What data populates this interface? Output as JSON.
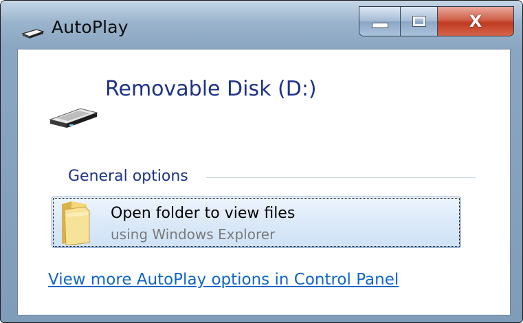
{
  "window": {
    "title": "AutoPlay",
    "title_icon": "autoplay-drive-icon",
    "controls": {
      "minimize_icon": "minimize-icon",
      "maximize_icon": "maximize-icon",
      "close_icon": "close-icon",
      "close_glyph": "X"
    }
  },
  "device": {
    "name": "Removable Disk (D:)",
    "icon": "removable-disk-icon"
  },
  "sections": {
    "general_label": "General options"
  },
  "options": [
    {
      "title": "Open folder to view files",
      "subtitle": "using Windows Explorer",
      "icon": "folder-icon"
    }
  ],
  "links": {
    "control_panel": "View more AutoPlay options in Control Panel"
  },
  "colors": {
    "heading_blue": "#1e3287",
    "link_blue": "#0f66c9",
    "close_red": "#c7432a"
  }
}
